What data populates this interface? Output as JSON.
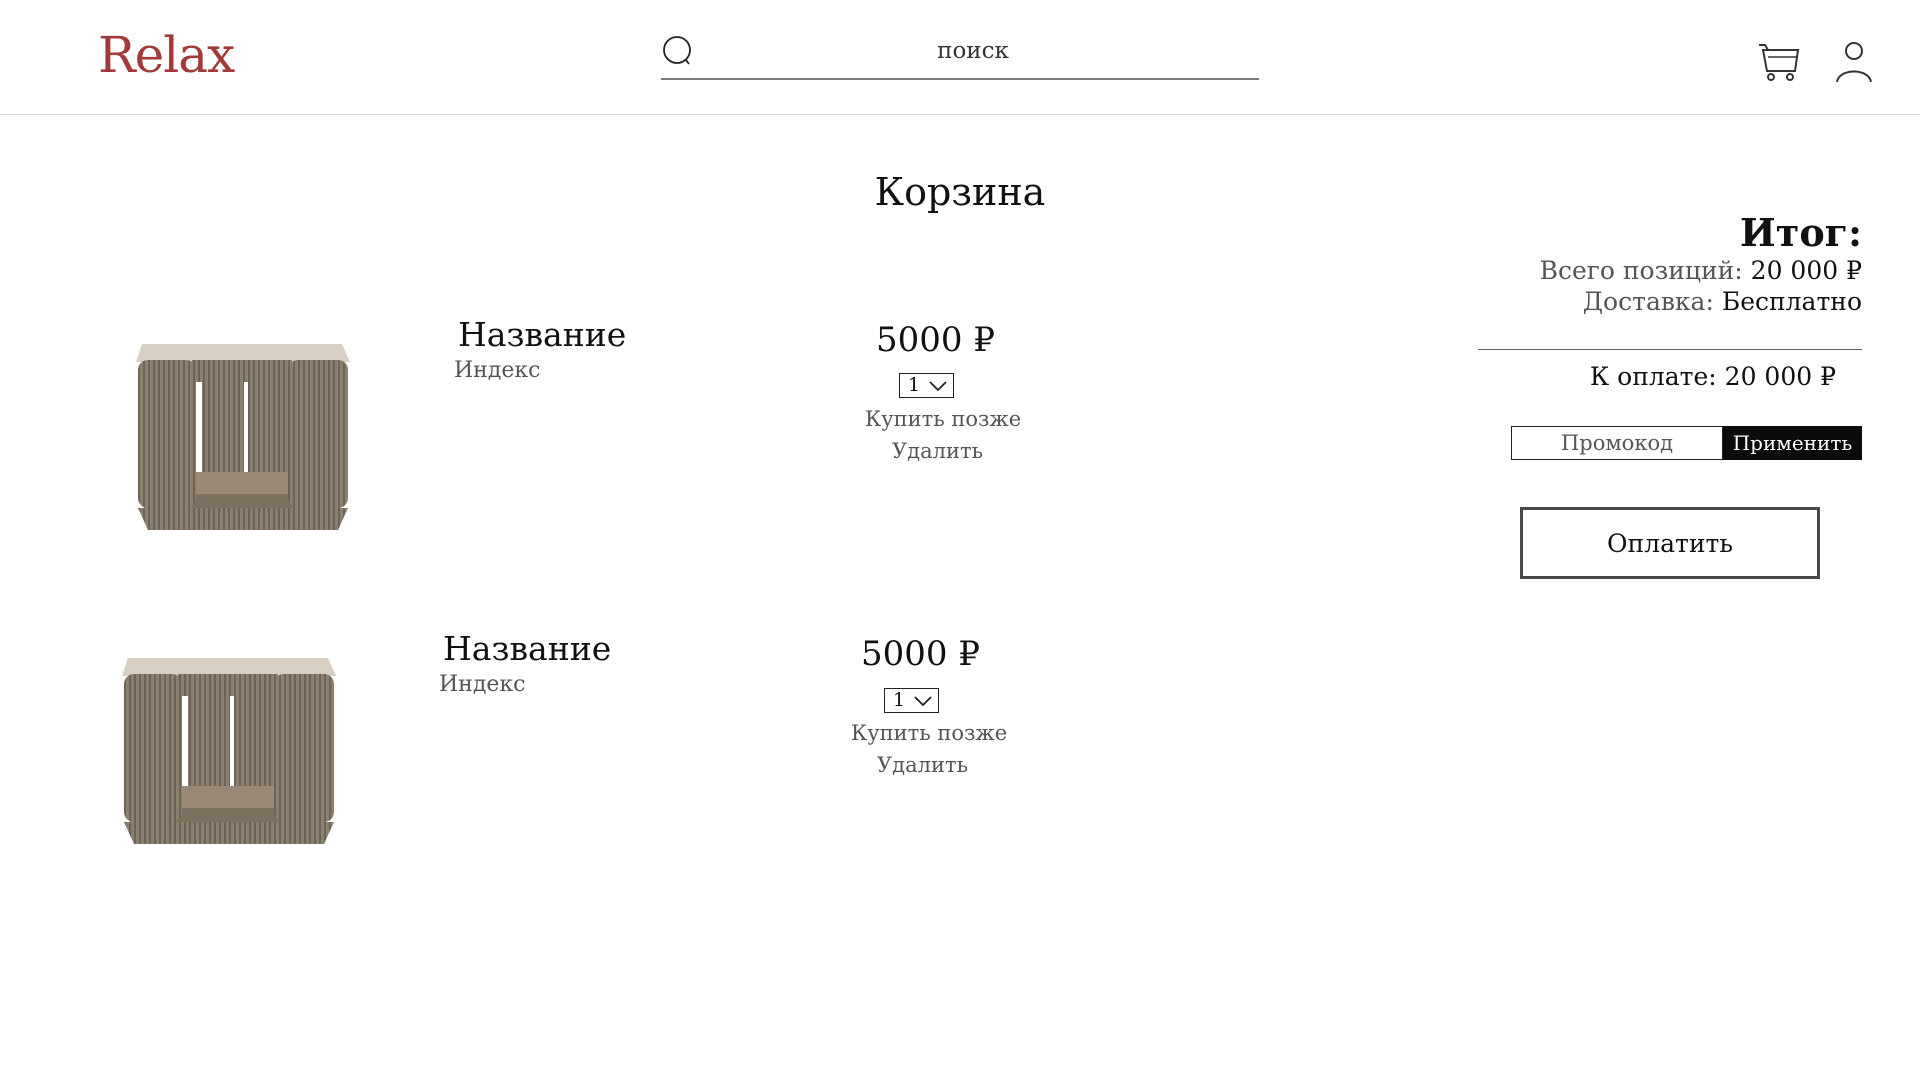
{
  "header": {
    "logo": "Relax",
    "search": {
      "placeholder": "поиск"
    },
    "cart_icon": "cart-icon",
    "user_icon": "user-icon"
  },
  "page": {
    "title": "Корзина"
  },
  "cart": {
    "items": [
      {
        "name": "Название",
        "index": "Индекс",
        "price": "5000 ₽",
        "quantity": "1",
        "buy_later": "Купить позже",
        "delete": "Удалить"
      },
      {
        "name": "Название",
        "index": "Индекс",
        "price": "5000 ₽",
        "quantity": "1",
        "buy_later": "Купить позже",
        "delete": "Удалить"
      }
    ]
  },
  "summary": {
    "title": "Итог:",
    "positions_label": "Всего позиций:",
    "positions_value": "20 000 ₽",
    "delivery_label": "Доставка:",
    "delivery_value": "Бесплатно",
    "pay_total": "К оплате:  20 000 ₽",
    "promo_placeholder": "Промокод",
    "apply_label": "Применить",
    "pay_label": "Оплатить"
  },
  "colors": {
    "logo": "#a33a3a",
    "apply_bg": "#0b0b0b"
  }
}
